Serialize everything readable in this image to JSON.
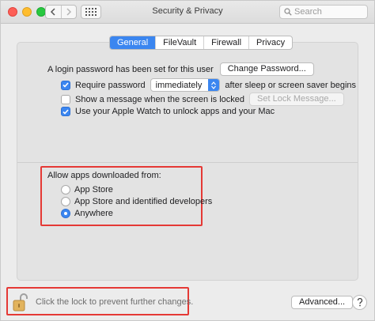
{
  "window": {
    "title": "Security & Privacy"
  },
  "toolbar": {
    "back_icon": "chevron-left-icon",
    "forward_icon": "chevron-right-icon",
    "grid_icon": "show-all-grid-icon",
    "search_placeholder": "Search"
  },
  "tabs": [
    {
      "label": "General",
      "active": true
    },
    {
      "label": "FileVault",
      "active": false
    },
    {
      "label": "Firewall",
      "active": false
    },
    {
      "label": "Privacy",
      "active": false
    }
  ],
  "general": {
    "login_password_text": "A login password has been set for this user",
    "change_password_button": "Change Password...",
    "require_password": {
      "label": "Require password",
      "checked": true
    },
    "require_password_select": "immediately",
    "after_sleep_text": "after sleep or screen saver begins",
    "show_message": {
      "label": "Show a message when the screen is locked",
      "checked": false
    },
    "set_lock_message_button": "Set Lock Message...",
    "apple_watch": {
      "label": "Use your Apple Watch to unlock apps and your Mac",
      "checked": true
    }
  },
  "allow_apps": {
    "heading": "Allow apps downloaded from:",
    "options": [
      {
        "label": "App Store",
        "selected": false
      },
      {
        "label": "App Store and identified developers",
        "selected": false
      },
      {
        "label": "Anywhere",
        "selected": true
      }
    ]
  },
  "footer": {
    "lock_icon": "unlocked-padlock-icon",
    "lock_text": "Click the lock to prevent further changes.",
    "advanced_button": "Advanced..."
  },
  "colors": {
    "accent": "#3b86f0",
    "highlight_box": "#e53935"
  }
}
